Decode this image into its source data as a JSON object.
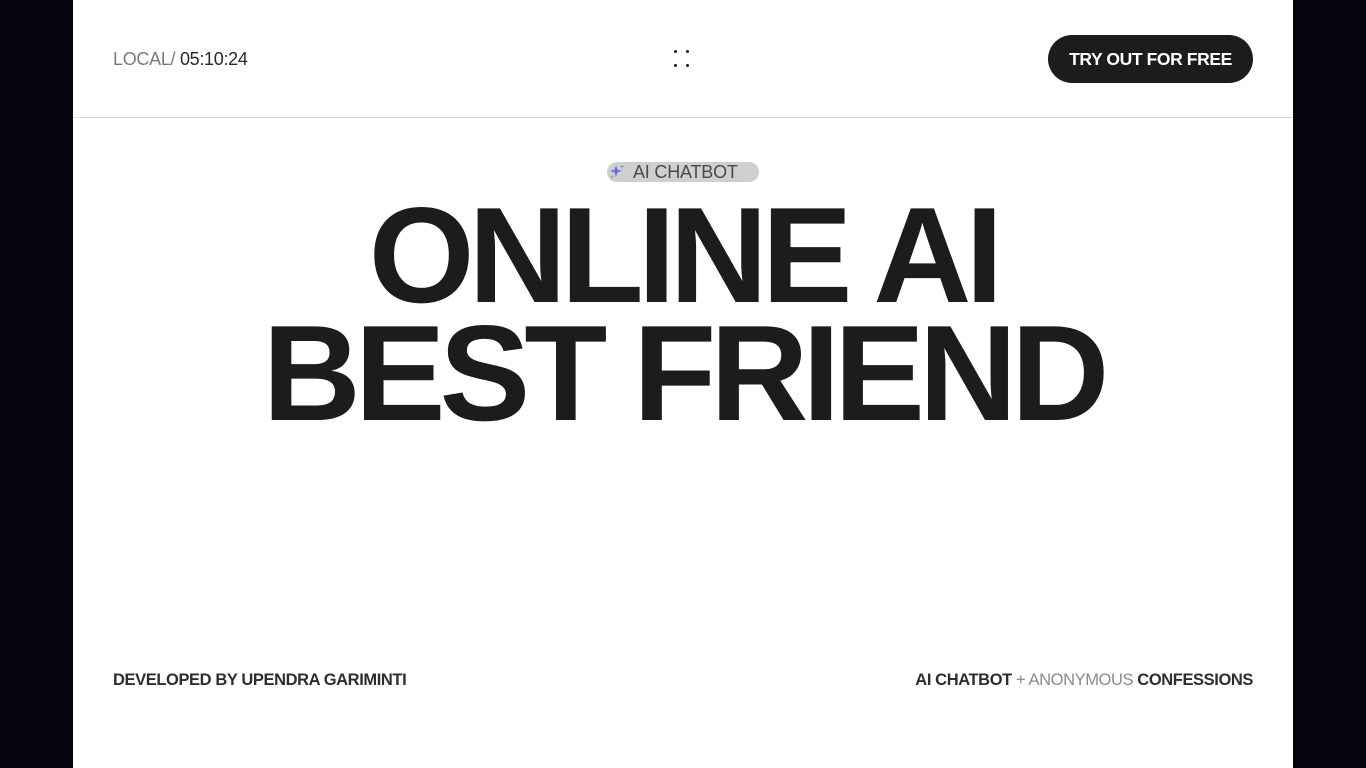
{
  "header": {
    "clock_label": "LOCAL",
    "clock_separator": "/",
    "clock_time": "05:10:24",
    "cta_label": "TRY OUT FOR FREE"
  },
  "hero": {
    "badge_label": "AI CHATBOT",
    "title_line_1": "ONLINE AI",
    "title_line_2": "BEST FRIEND"
  },
  "footer": {
    "credit": "DEVELOPED BY UPENDRA GARIMINTI",
    "tagline_part_1": "AI CHATBOT",
    "tagline_plus": "+",
    "tagline_part_2": "ANONYMOUS",
    "tagline_part_3": "CONFESSIONS"
  },
  "icons": {
    "menu": "dots-grid-icon",
    "badge": "sparkle-icon"
  },
  "colors": {
    "background": "#05050f",
    "page": "#ffffff",
    "text_dark": "#1c1c1e",
    "cta_background": "#1c1c1e",
    "badge_background": "#cfcfcf",
    "sparkle": "#6a6ce8"
  }
}
